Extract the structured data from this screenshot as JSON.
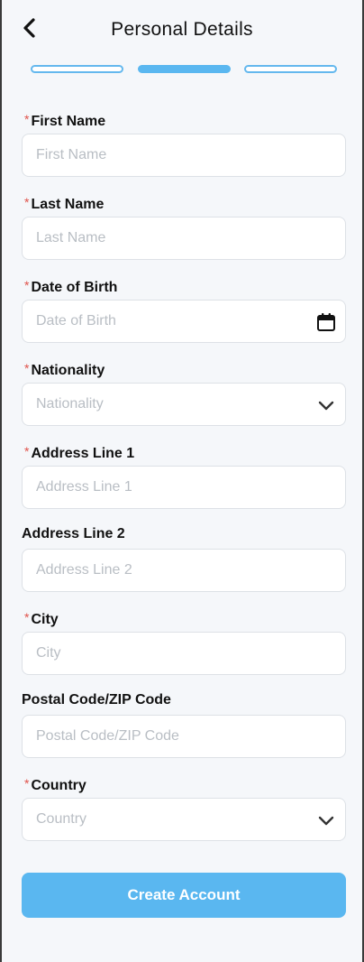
{
  "header": {
    "title": "Personal Details",
    "back_icon": "chevron-left-icon"
  },
  "progress": {
    "steps": 3,
    "current_step": 2,
    "accent_color": "#5ab7f0"
  },
  "form": {
    "required_marker": "*",
    "fields": [
      {
        "label": "First Name",
        "placeholder": "First Name",
        "required": true
      },
      {
        "label": "Last Name",
        "placeholder": "Last Name",
        "required": true
      },
      {
        "label": "Date of Birth",
        "placeholder": "Date of Birth",
        "required": true,
        "icon": "calendar-icon"
      },
      {
        "label": "Nationality",
        "placeholder": "Nationality",
        "required": true,
        "icon": "chevron-down-icon"
      },
      {
        "label": "Address Line 1",
        "placeholder": "Address Line 1",
        "required": true
      },
      {
        "label": "Address Line 2",
        "placeholder": "Address Line 2",
        "required": false
      },
      {
        "label": "City",
        "placeholder": "City",
        "required": true
      },
      {
        "label": "Postal Code/ZIP Code",
        "placeholder": "Postal Code/ZIP Code",
        "required": false
      },
      {
        "label": "Country",
        "placeholder": "Country",
        "required": true,
        "icon": "chevron-down-icon"
      }
    ]
  },
  "submit": {
    "label": "Create Account"
  }
}
